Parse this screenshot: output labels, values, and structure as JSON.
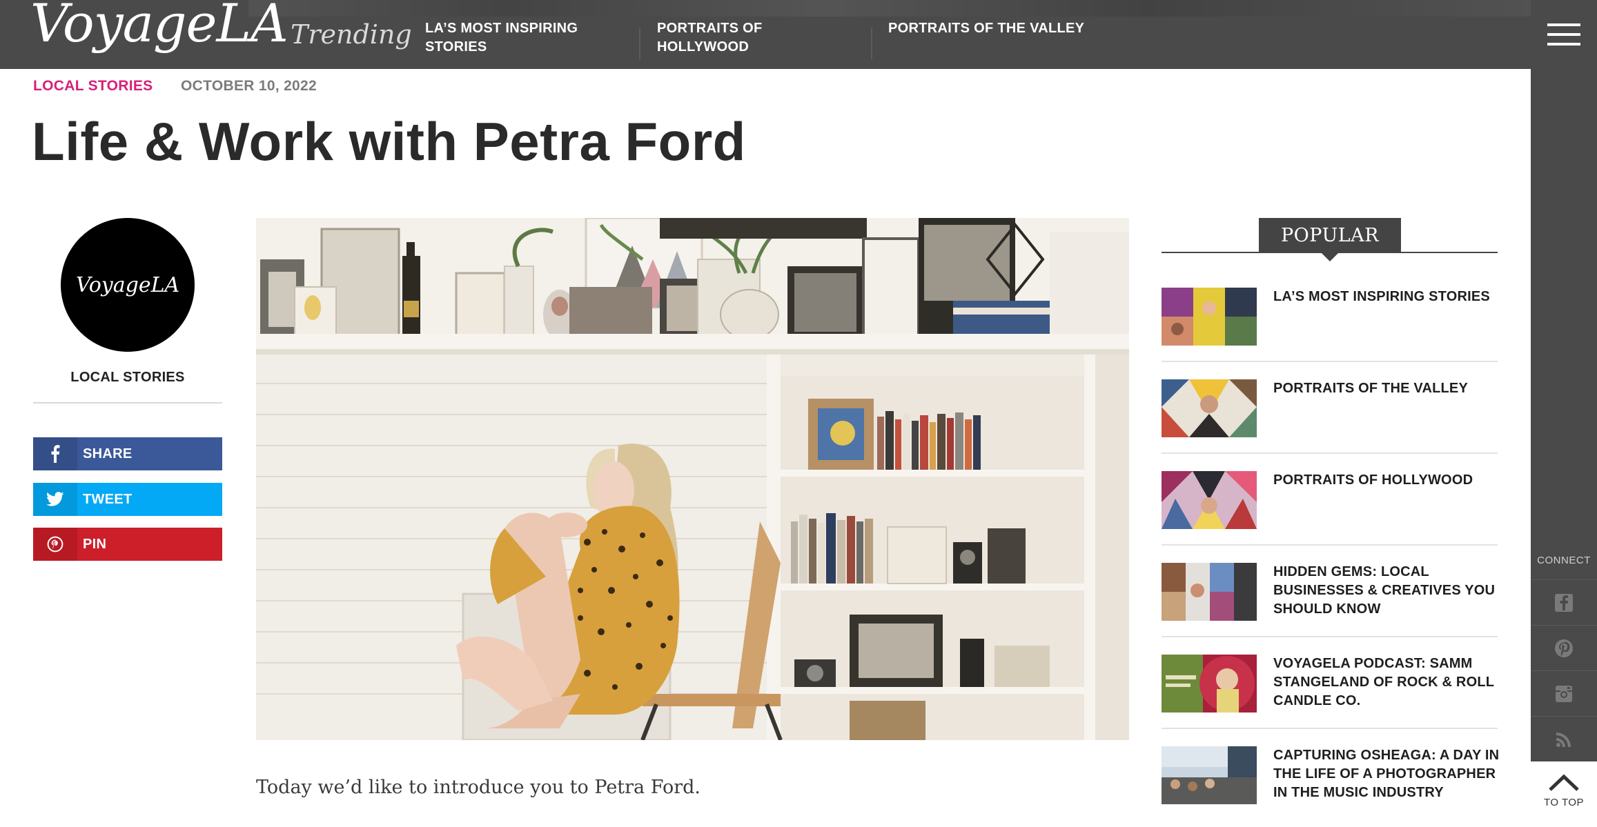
{
  "header": {
    "logo": "VoyageLA",
    "trending_label": "Trending",
    "trending_items": [
      {
        "label": "LA’S MOST INSPIRING STORIES"
      },
      {
        "label": "PORTRAITS OF HOLLYWOOD"
      },
      {
        "label": "PORTRAITS OF THE VALLEY"
      }
    ],
    "menu_icon": "hamburger-menu-icon"
  },
  "article": {
    "category": "LOCAL STORIES",
    "date": "OCTOBER 10, 2022",
    "title": "Life & Work with Petra Ford",
    "intro": "Today we’d like to introduce you to Petra Ford."
  },
  "author": {
    "avatar_text": "VoyageLA",
    "category": "LOCAL STORIES"
  },
  "share": {
    "facebook": "SHARE",
    "twitter": "TWEET",
    "pinterest": "PIN"
  },
  "popular": {
    "heading": "POPULAR",
    "items": [
      {
        "title": "LA’S MOST INSPIRING STORIES"
      },
      {
        "title": "PORTRAITS OF THE VALLEY"
      },
      {
        "title": "PORTRAITS OF HOLLYWOOD"
      },
      {
        "title": "HIDDEN GEMS: LOCAL BUSINESSES & CREATIVES YOU SHOULD KNOW"
      },
      {
        "title": "VOYAGELA PODCAST: SAMM STANGELAND OF ROCK & ROLL CANDLE CO."
      },
      {
        "title": "CAPTURING OSHEAGA: A DAY IN THE LIFE OF A PHOTOGRAPHER IN THE MUSIC INDUSTRY"
      }
    ]
  },
  "sidebar": {
    "connect_label": "CONNECT",
    "icons": [
      "facebook-icon",
      "pinterest-icon",
      "instagram-icon",
      "rss-icon"
    ],
    "to_top_label": "TO TOP"
  },
  "colors": {
    "accent": "#d6207a",
    "bar": "#4a4a4a",
    "facebook": "#3b5998",
    "twitter": "#03a9f4",
    "pinterest": "#cc1f2a"
  }
}
